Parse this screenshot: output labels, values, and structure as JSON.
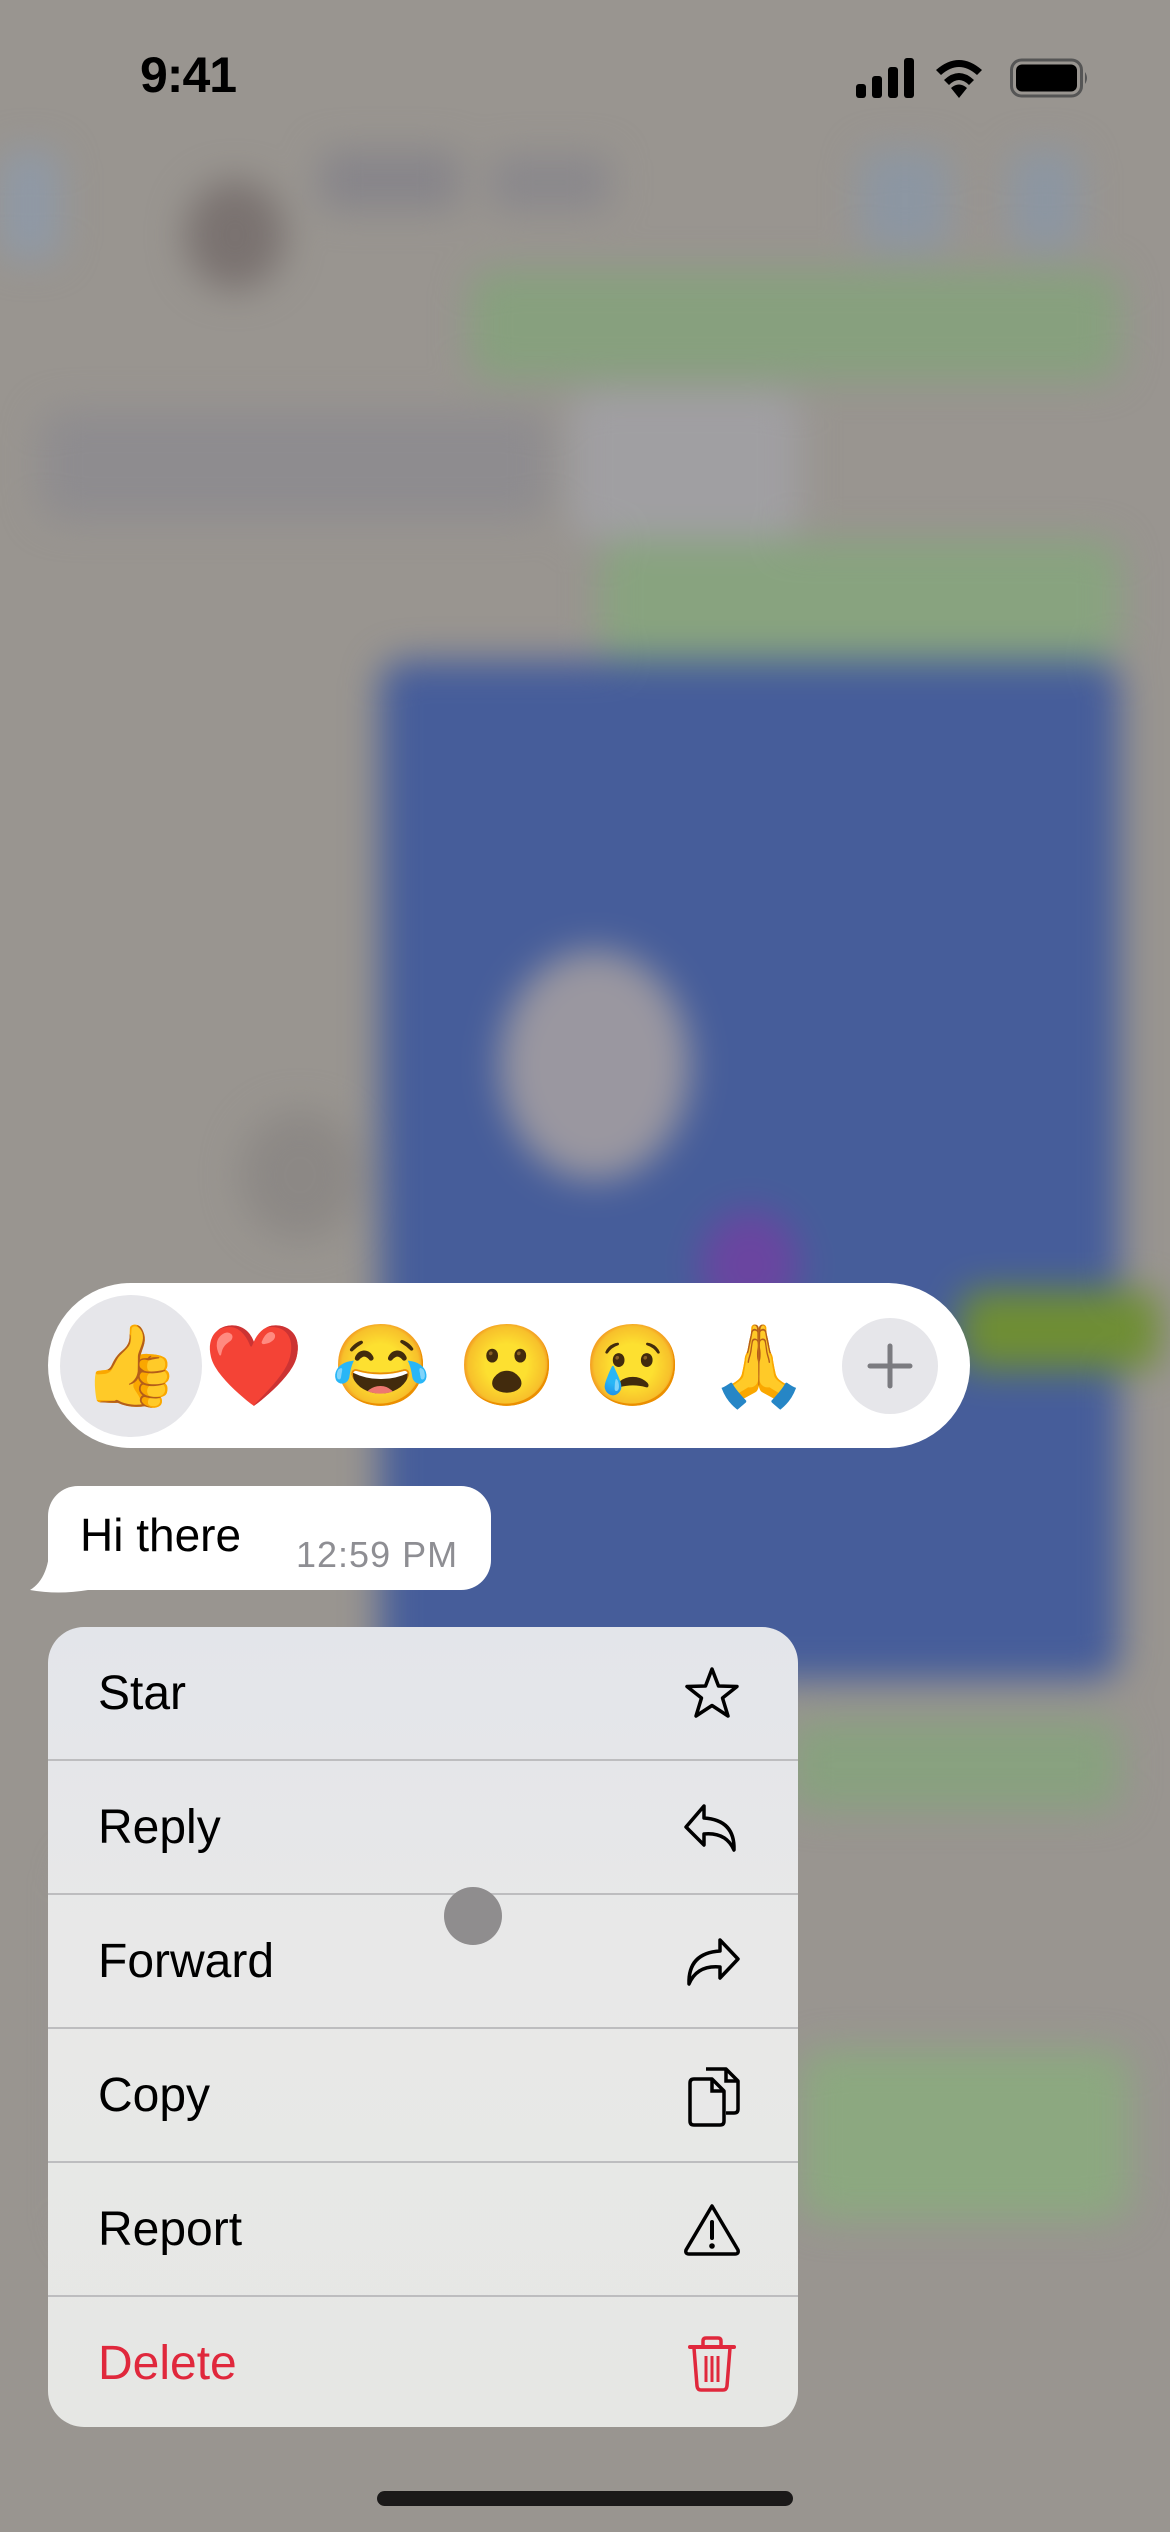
{
  "status_bar": {
    "time": "9:41",
    "icons": [
      "cellular-signal-icon",
      "wifi-icon",
      "battery-icon"
    ]
  },
  "reactions": {
    "items": [
      {
        "emoji": "👍",
        "name": "thumbs-up",
        "selected": true
      },
      {
        "emoji": "❤️",
        "name": "red-heart",
        "selected": false
      },
      {
        "emoji": "😂",
        "name": "face-with-tears-of-joy",
        "selected": false
      },
      {
        "emoji": "😮",
        "name": "face-with-open-mouth",
        "selected": false
      },
      {
        "emoji": "😢",
        "name": "crying-face",
        "selected": false
      },
      {
        "emoji": "🙏",
        "name": "folded-hands",
        "selected": false
      }
    ],
    "more_icon": "plus-icon"
  },
  "message": {
    "text": "Hi there",
    "time": "12:59 PM"
  },
  "context_menu": {
    "items": [
      {
        "label": "Star",
        "icon": "star-icon",
        "destructive": false
      },
      {
        "label": "Reply",
        "icon": "reply-icon",
        "destructive": false
      },
      {
        "label": "Forward",
        "icon": "forward-icon",
        "destructive": false
      },
      {
        "label": "Copy",
        "icon": "copy-icon",
        "destructive": false
      },
      {
        "label": "Report",
        "icon": "warning-icon",
        "destructive": false
      },
      {
        "label": "Delete",
        "icon": "trash-icon",
        "destructive": true
      }
    ]
  },
  "colors": {
    "destructive": "#e0283c",
    "overlay_bg": "#999590",
    "reaction_selected_bg": "#e6e6ea",
    "timestamp": "#8e8e93"
  }
}
